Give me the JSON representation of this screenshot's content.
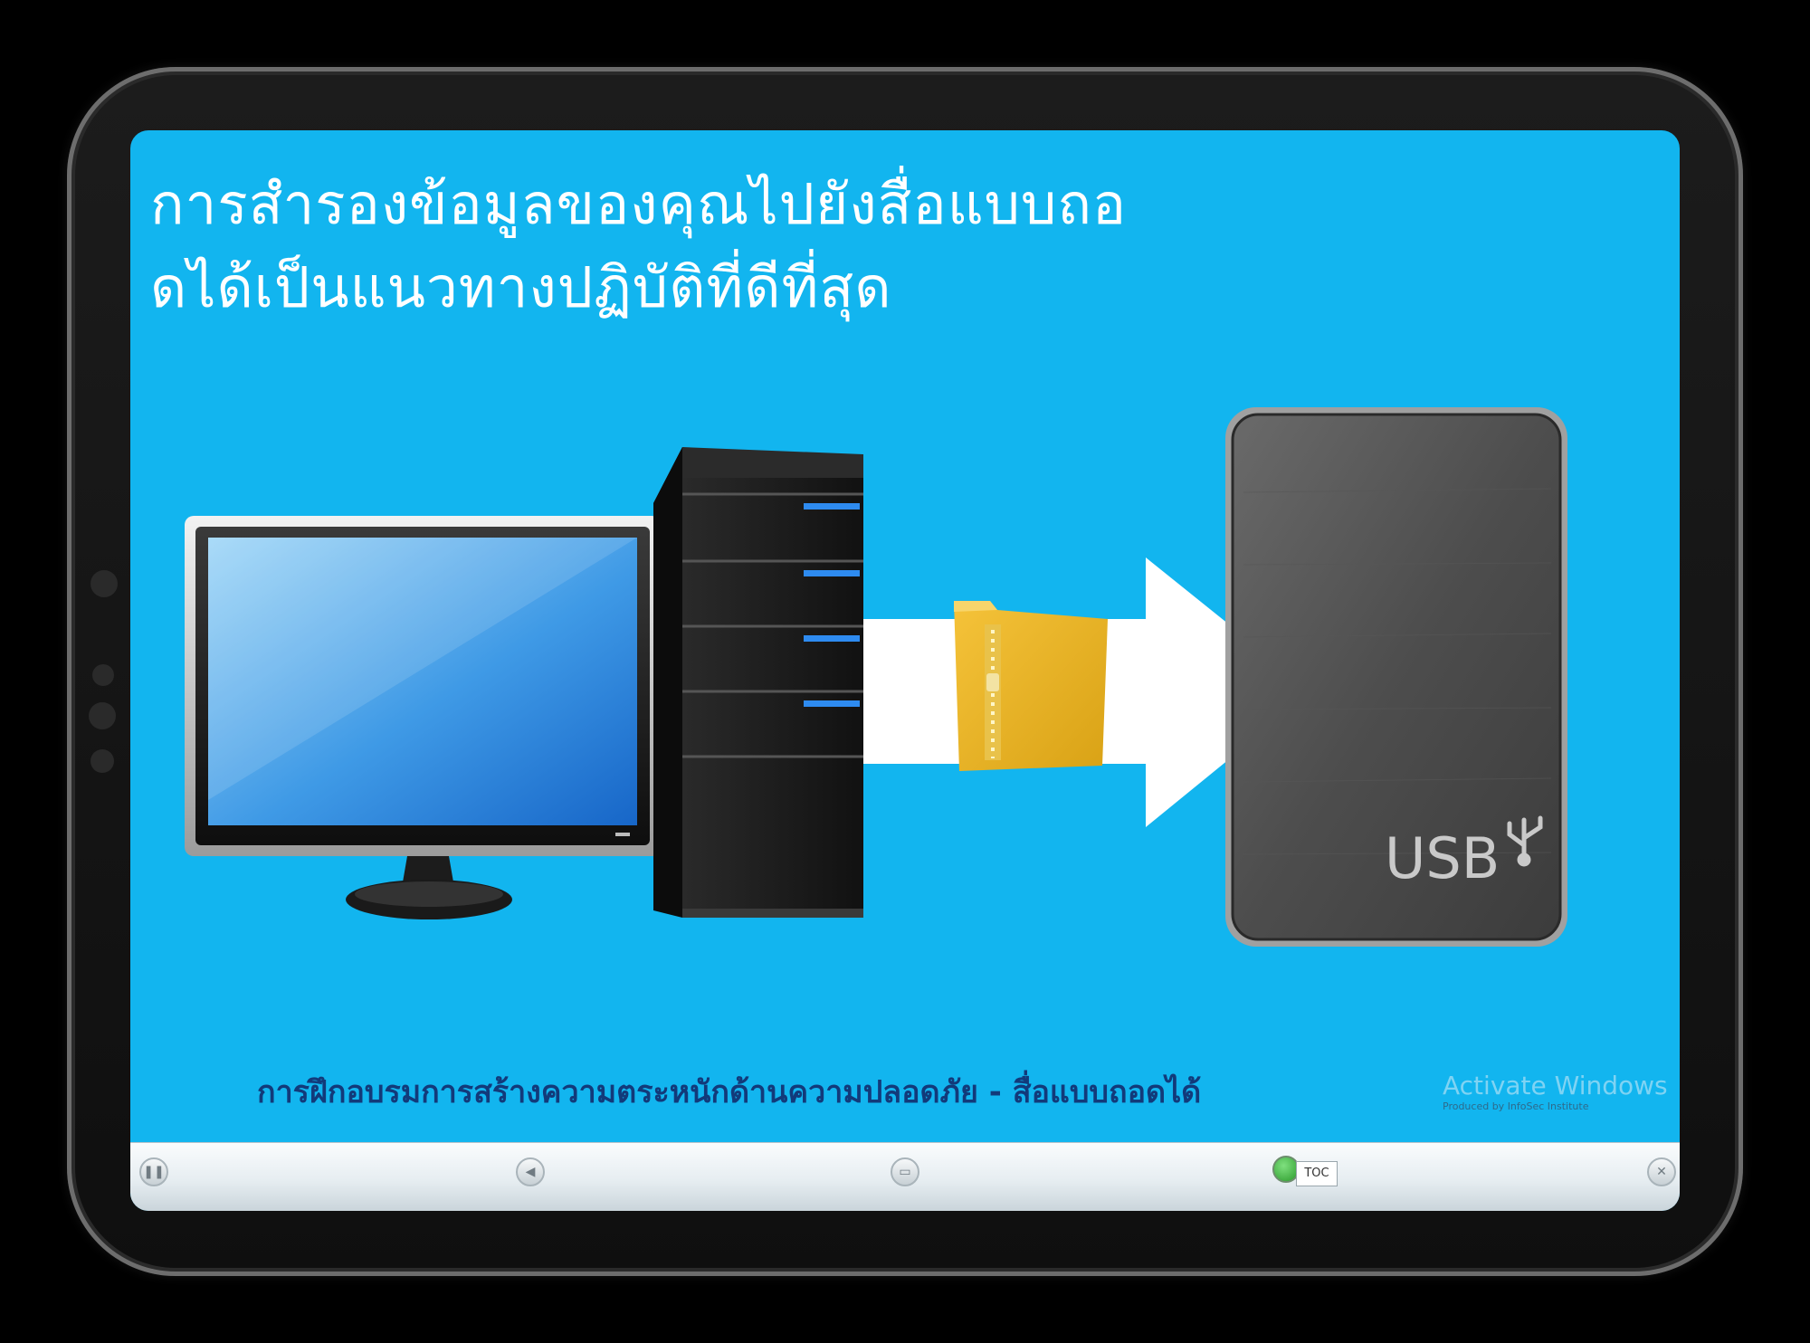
{
  "slide": {
    "title": "การสำรองข้อมูลของคุณไปยังสื่อแบบถอ\nดได้เป็นแนวทางปฏิบัติที่ดีที่สุด",
    "caption": "การฝึกอบรมการสร้างความตระหนักด้านความปลอดภัย - สื่อแบบถอดได้",
    "usb_label": "USB",
    "background_color": "#12b5ef"
  },
  "watermark": {
    "line1": "Activate Windows",
    "line2": "Produced by InfoSec Institute"
  },
  "toolbar": {
    "toc_label": "TOC",
    "icons": [
      "pause-icon",
      "volume-icon",
      "captions-icon",
      "toc-icon",
      "close-icon"
    ]
  }
}
